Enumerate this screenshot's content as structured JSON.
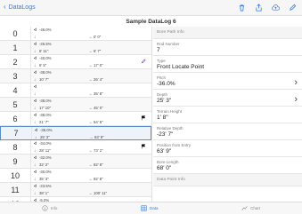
{
  "nav": {
    "back_label": "DataLogs"
  },
  "title": "Sample DataLog 6",
  "rows": [
    {
      "index": "0",
      "c1": "-46.0%",
      "c2": "",
      "c3": "0' 0\""
    },
    {
      "index": "1",
      "c1": "-26.5%",
      "c2": "6' 11\"",
      "c3": "6' 7\""
    },
    {
      "index": "2",
      "c1": "-40.0%",
      "c2": "6' 5\"",
      "c3": "17' 0\""
    },
    {
      "index": "3",
      "c1": "-38.0%",
      "c2": "10' 7\"",
      "c3": "26' 4\""
    },
    {
      "index": "4",
      "c1": "",
      "c2": "",
      "c3": "35' 8\""
    },
    {
      "index": "5",
      "c1": "-38.0%",
      "c2": "17' 10\"",
      "c3": "45' 0\""
    },
    {
      "index": "6",
      "c1": "-38.0%",
      "c2": "21' 7\"",
      "c3": "54' 5\""
    },
    {
      "index": "7",
      "c1": "-36.0%",
      "c2": "25' 3\"",
      "c3": "63' 9\""
    },
    {
      "index": "8",
      "c1": "-34.0%",
      "c2": "28' 11\"",
      "c3": "73' 2\""
    },
    {
      "index": "9",
      "c1": "-32.0%",
      "c2": "32' 2\"",
      "c3": "82' 8\""
    },
    {
      "index": "10",
      "c1": "-30.0%",
      "c2": "35' 3\"",
      "c3": "92' 8\""
    },
    {
      "index": "11",
      "c1": "-23.5%",
      "c2": "38' 1\"",
      "c3": "100' 11\""
    },
    {
      "index": "12",
      "c1": "-5.0%",
      "c2": "",
      "c3": ""
    }
  ],
  "bore_path": {
    "section_label": "Bore Path Info",
    "rod_number_label": "Rod Number",
    "rod_number_value": "7",
    "type_label": "Type",
    "type_value": "Front Locate Point",
    "pitch_label": "Pitch",
    "pitch_value": "-36.0%",
    "depth_label": "Depth",
    "depth_value": "25' 3\"",
    "terrain_label": "Terrain Height",
    "terrain_value": "1' 8\"",
    "rel_depth_label": "Relative Depth",
    "rel_depth_value": "-23' 7\"",
    "position_label": "Position from Entry",
    "position_value": "63' 9\"",
    "bore_length_label": "Bore Length",
    "bore_length_value": "68' 0\""
  },
  "data_point": {
    "section_label": "Data Point Info"
  },
  "tabs": {
    "info": "Info",
    "data": "Data",
    "chart": "Chart"
  },
  "colors": {
    "accent": "#2f7bf0",
    "selected_border": "#5a8ec6"
  }
}
